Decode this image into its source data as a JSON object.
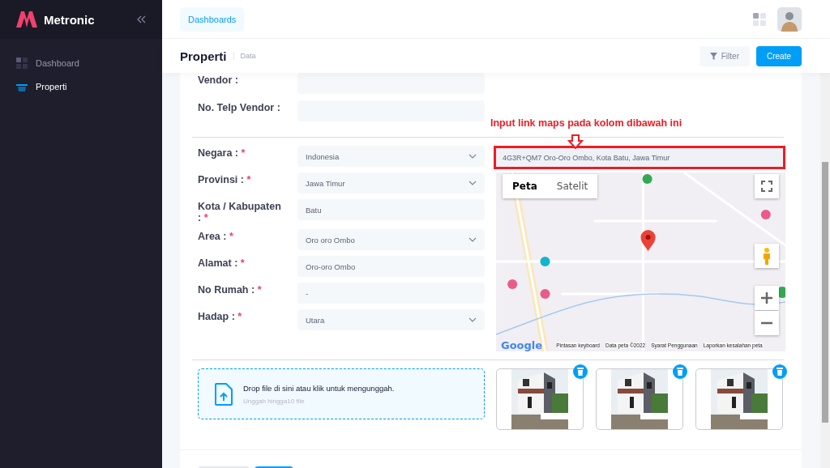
{
  "sidebar": {
    "brand": "Metronic",
    "items": [
      {
        "label": "Dashboard",
        "kind": "grid",
        "selected": false
      },
      {
        "label": "Properti",
        "kind": "basket",
        "selected": true
      }
    ]
  },
  "header": {
    "breadcrumb": "Dashboards"
  },
  "toolbar": {
    "title": "Properti",
    "subtitle": "Data",
    "buttons": [
      {
        "label": "Filter",
        "kind": "filter"
      },
      {
        "label": "Create",
        "kind": "primary"
      }
    ]
  },
  "vendor_fields": [
    {
      "label": "Vendor :"
    },
    {
      "label": "No. Telp Vendor :"
    }
  ],
  "location_fields": [
    {
      "label": "Negara :",
      "required_mark": "*",
      "kind": "select",
      "value": "Indonesia"
    },
    {
      "label": "Provinsi :",
      "required_mark": "*",
      "kind": "select",
      "value": "Jawa Timur"
    },
    {
      "label": "Kota / Kabupaten :",
      "required_mark": "*",
      "kind": "text",
      "value": "Batu"
    },
    {
      "label": "Area :",
      "required_mark": "*",
      "kind": "select",
      "value": "Oro oro Ombo"
    },
    {
      "label": "Alamat :",
      "required_mark": "*",
      "kind": "text",
      "value": "Oro-oro Ombo"
    },
    {
      "label": "No Rumah :",
      "required_mark": "*",
      "kind": "text",
      "value": "-"
    },
    {
      "label": "Hadap :",
      "required_mark": "*",
      "kind": "select",
      "value": "Utara"
    }
  ],
  "map": {
    "annotation": "Input link maps pada kolom dibawah ini",
    "link_value": "4G3R+QM7 Oro-Oro Ombo, Kota Batu, Jawa Timur",
    "map_types": [
      {
        "label": "Peta",
        "selected": true
      },
      {
        "label": "Satelit",
        "selected": false
      }
    ],
    "logo": "Google",
    "footer": [
      "Pintasan keyboard",
      "Data peta ©2022",
      "Syarat Penggunaan",
      "Laporkan kesalahan peta"
    ]
  },
  "upload": {
    "title": "Drop file di sini atau klik untuk mengunggah.",
    "hint": "Unggah hingga10 file"
  }
}
